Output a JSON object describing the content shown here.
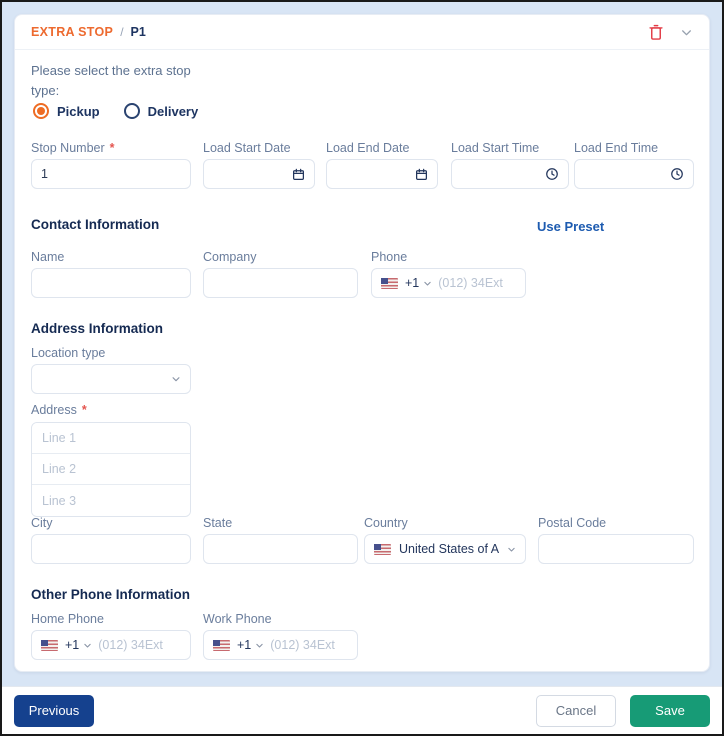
{
  "header": {
    "breadcrumb": {
      "section": "EXTRA STOP",
      "separator": "/",
      "page": "P1"
    }
  },
  "prompt": "Please select the extra stop type:",
  "stop_type": {
    "options": [
      {
        "label": "Pickup",
        "selected": true
      },
      {
        "label": "Delivery",
        "selected": false
      }
    ]
  },
  "sections": {
    "contact": "Contact Information",
    "use_preset": "Use Preset",
    "address": "Address Information",
    "other_phone": "Other Phone Information"
  },
  "fields": {
    "stop_number": {
      "label": "Stop Number",
      "required": "*",
      "value": "1"
    },
    "load_start_date": {
      "label": "Load Start Date",
      "value": ""
    },
    "load_end_date": {
      "label": "Load End Date",
      "value": ""
    },
    "load_start_time": {
      "label": "Load Start Time",
      "value": ""
    },
    "load_end_time": {
      "label": "Load End Time",
      "value": ""
    },
    "name": {
      "label": "Name",
      "value": ""
    },
    "company": {
      "label": "Company",
      "value": ""
    },
    "phone": {
      "label": "Phone",
      "dial_code": "+1",
      "placeholder": "(012) 34Ext"
    },
    "location_type": {
      "label": "Location type",
      "value": ""
    },
    "address": {
      "label": "Address",
      "required": "*",
      "line_placeholders": [
        "Line 1",
        "Line 2",
        "Line 3"
      ]
    },
    "city": {
      "label": "City",
      "value": ""
    },
    "state": {
      "label": "State",
      "value": ""
    },
    "country": {
      "label": "Country",
      "value": "United States of A"
    },
    "postal_code": {
      "label": "Postal Code",
      "value": ""
    },
    "home_phone": {
      "label": "Home Phone",
      "dial_code": "+1",
      "placeholder": "(012) 34Ext"
    },
    "work_phone": {
      "label": "Work Phone",
      "dial_code": "+1",
      "placeholder": "(012) 34Ext"
    }
  },
  "footer": {
    "previous": "Previous",
    "cancel": "Cancel",
    "save": "Save"
  },
  "icons": {
    "delete": "trash-icon",
    "collapse": "chevron-down-icon",
    "date": "calendar-icon",
    "time": "clock-icon",
    "dropdown": "chevron-down-icon",
    "flag": "us-flag-icon"
  },
  "colors": {
    "accent_orange": "#ED6A2F",
    "link_blue": "#1D5BB0",
    "primary_blue": "#15418E",
    "success_green": "#179B76",
    "danger_red": "#E23B45",
    "page_bg": "#D8E5F5",
    "label_gray": "#6A7D9C",
    "heading_navy": "#152A52"
  }
}
